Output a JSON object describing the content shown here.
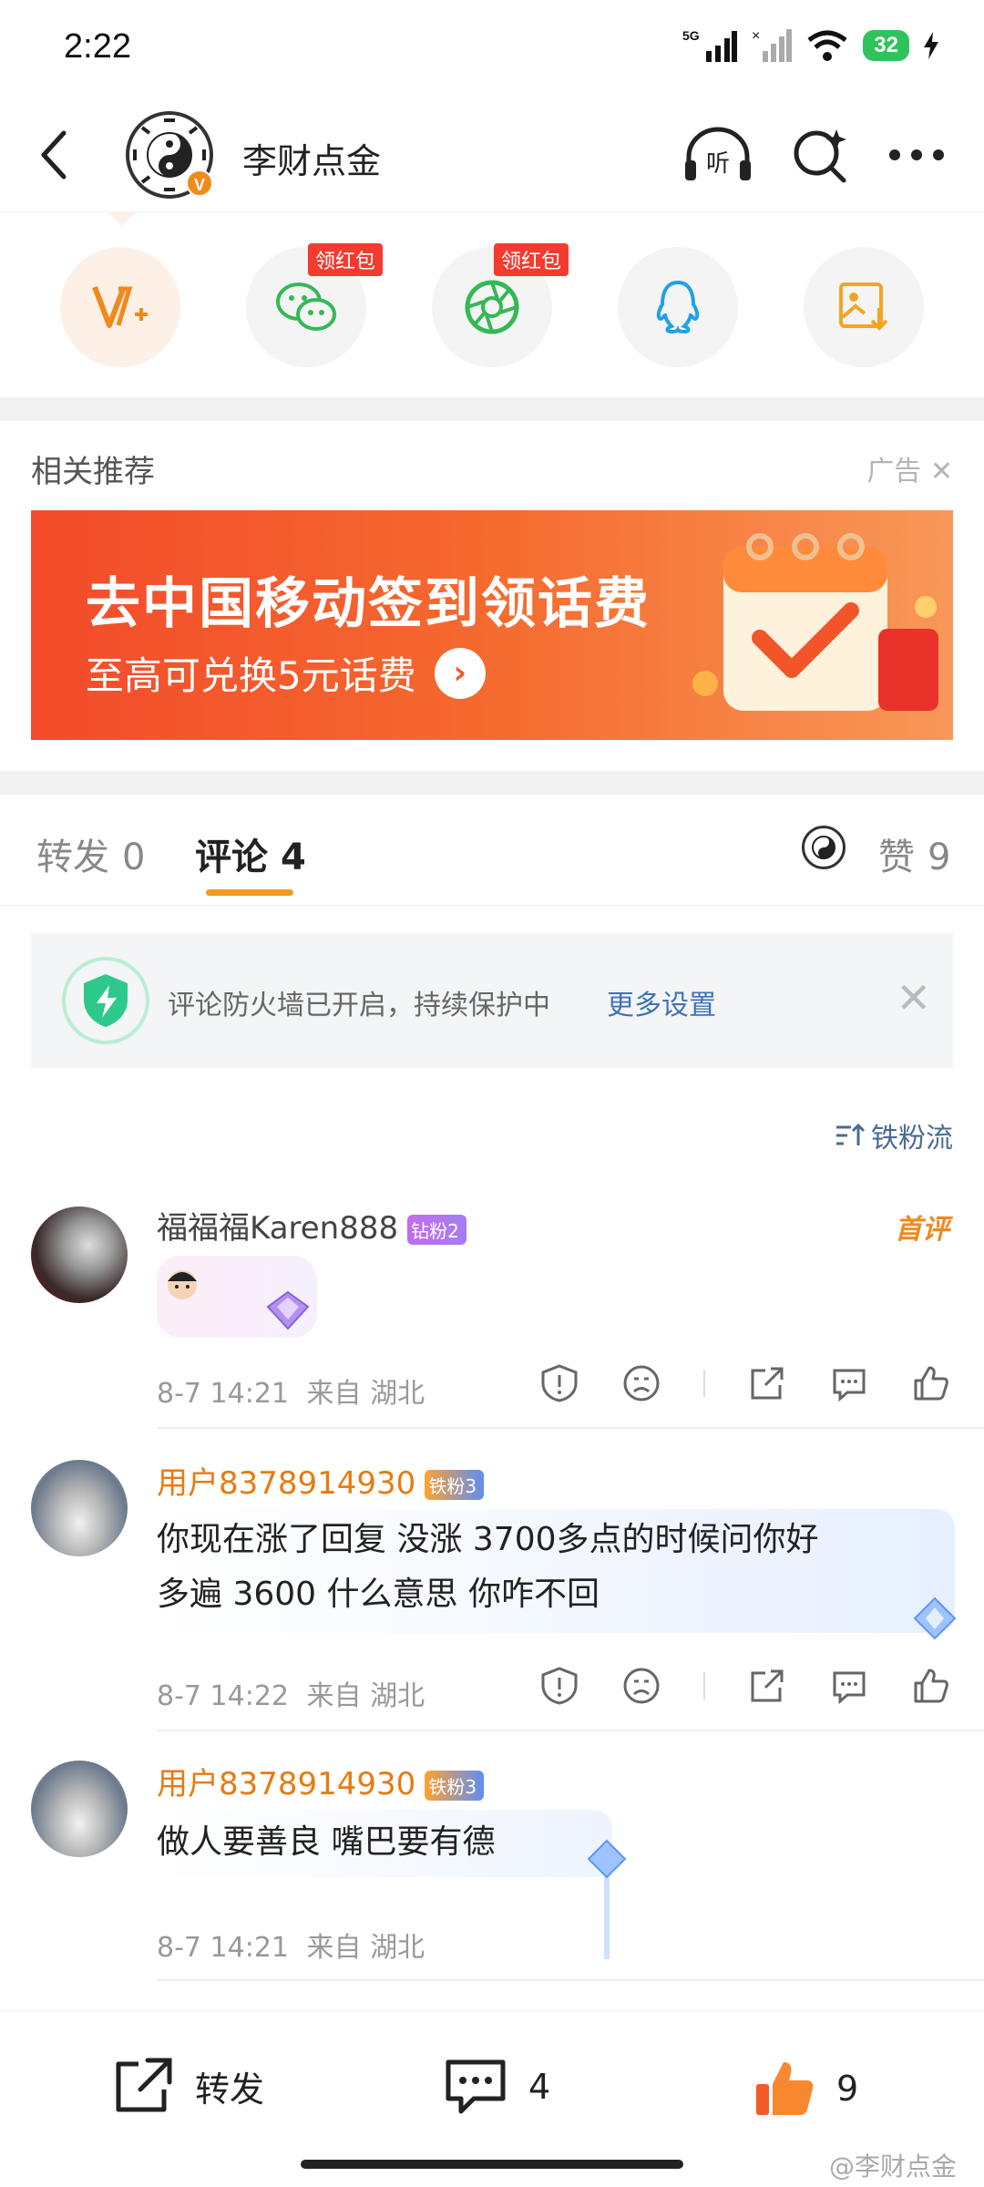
{
  "status_bar": {
    "time": "2:22",
    "network": "5G",
    "battery": "32"
  },
  "header": {
    "account_name": "李财点金",
    "verified_mark": "V"
  },
  "share_row": {
    "items": [
      {
        "icon": "vip-plus-icon",
        "tag": ""
      },
      {
        "icon": "wechat-icon",
        "tag": "领红包"
      },
      {
        "icon": "moments-icon",
        "tag": "领红包"
      },
      {
        "icon": "qq-icon",
        "tag": ""
      },
      {
        "icon": "save-image-icon",
        "tag": ""
      }
    ]
  },
  "recommend": {
    "title": "相关推荐",
    "ad_tag": "广告",
    "ad_headline": "去中国移动签到领话费",
    "ad_sub": "至高可兑换5元话费"
  },
  "tabs": {
    "repost_label": "转发",
    "repost_count": "0",
    "comment_label": "评论",
    "comment_count": "4",
    "like_label": "赞",
    "like_count": "9"
  },
  "notice": {
    "text": "评论防火墙已开启，持续保护中",
    "link": "更多设置"
  },
  "sort_label": "铁粉流",
  "comments": [
    {
      "name": "福福福Karen888",
      "badge": "钻粉2",
      "first_label": "首评",
      "text": "",
      "time": "8-7 14:21",
      "location": "来自 湖北"
    },
    {
      "name": "用户8378914930",
      "badge": "铁粉3",
      "text_line1": "你现在涨了回复 没涨 3700多点的时候问你好",
      "text_line2": "多遍 3600 什么意思 你咋不回",
      "time": "8-7 14:22",
      "location": "来自 湖北"
    },
    {
      "name": "用户8378914930",
      "badge": "铁粉3",
      "text": "做人要善良 嘴巴要有德",
      "time": "8-7 14:21",
      "location": "来自 湖北"
    }
  ],
  "bottom_bar": {
    "repost_label": "转发",
    "comment_count": "4",
    "like_count": "9"
  },
  "watermark": "@李财点金",
  "colors": {
    "accent_orange": "#f39a1c",
    "link_blue": "#3f72b5",
    "red_tag": "#f33b2f",
    "name_orange": "#e87a12"
  }
}
